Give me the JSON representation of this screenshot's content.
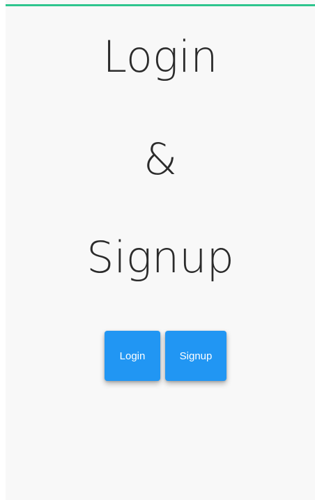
{
  "header": {
    "accent_color": "#2fc58e"
  },
  "title": {
    "line1": "Login",
    "line2": "&",
    "line3": "Signup"
  },
  "actions": {
    "login_label": "Login",
    "signup_label": "Signup",
    "button_color": "#2196f3"
  }
}
